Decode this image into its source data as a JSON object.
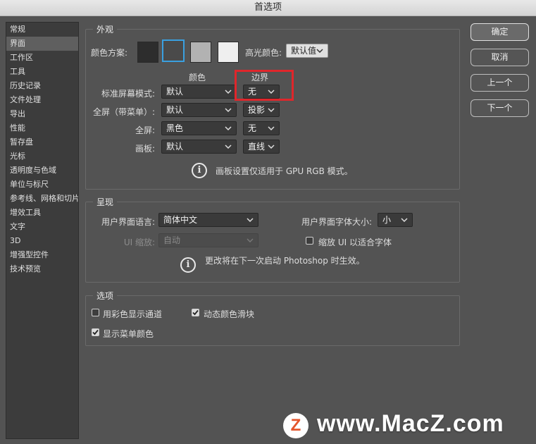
{
  "window": {
    "title": "首选项"
  },
  "sidebar": {
    "items": [
      {
        "label": "常规"
      },
      {
        "label": "界面",
        "selected": true
      },
      {
        "label": "工作区"
      },
      {
        "label": "工具"
      },
      {
        "label": "历史记录"
      },
      {
        "label": "文件处理"
      },
      {
        "label": "导出"
      },
      {
        "label": "性能"
      },
      {
        "label": "暂存盘"
      },
      {
        "label": "光标"
      },
      {
        "label": "透明度与色域"
      },
      {
        "label": "单位与标尺"
      },
      {
        "label": "参考线、网格和切片"
      },
      {
        "label": "增效工具"
      },
      {
        "label": "文字"
      },
      {
        "label": "3D"
      },
      {
        "label": "增强型控件"
      },
      {
        "label": "技术预览"
      }
    ]
  },
  "appearance": {
    "legend": "外观",
    "color_scheme_label": "颜色方案:",
    "swatches": [
      "#2d2d2d",
      "#4a4a4a",
      "#b2b2b2",
      "#efefef"
    ],
    "selected_swatch_border": "#3aa0e0",
    "highlight_color_label": "高光颜色:",
    "highlight_color_value": "默认值",
    "col_color": "颜色",
    "col_border": "边界",
    "rows": [
      {
        "label": "标准屏幕模式:",
        "color": "默认",
        "border": "无"
      },
      {
        "label": "全屏（带菜单）:",
        "color": "默认",
        "border": "投影"
      },
      {
        "label": "全屏:",
        "color": "黑色",
        "border": "无"
      },
      {
        "label": "画板:",
        "color": "默认",
        "border": "直线"
      }
    ],
    "info": "画板设置仅适用于 GPU RGB 模式。"
  },
  "presentation": {
    "legend": "呈现",
    "ui_language_label": "用户界面语言:",
    "ui_language_value": "简体中文",
    "ui_font_size_label": "用户界面字体大小:",
    "ui_font_size_value": "小",
    "ui_scaling_label": "UI 缩放:",
    "ui_scaling_value": "自动",
    "scale_ui_to_font_label": "缩放 UI 以适合字体",
    "info": "更改将在下一次启动 Photoshop 时生效。"
  },
  "options": {
    "legend": "选项",
    "show_channels_in_color": {
      "label": "用彩色显示通道",
      "checked": false
    },
    "dynamic_color_sliders": {
      "label": "动态颜色滑块",
      "checked": true
    },
    "show_menu_colors": {
      "label": "显示菜单颜色",
      "checked": true
    }
  },
  "buttons": {
    "ok": "确定",
    "cancel": "取消",
    "prev": "上一个",
    "next": "下一个"
  },
  "watermark": {
    "logo": "Z",
    "text": "www.MacZ.com"
  },
  "colors": {
    "annotation_box": "#e0262b"
  }
}
